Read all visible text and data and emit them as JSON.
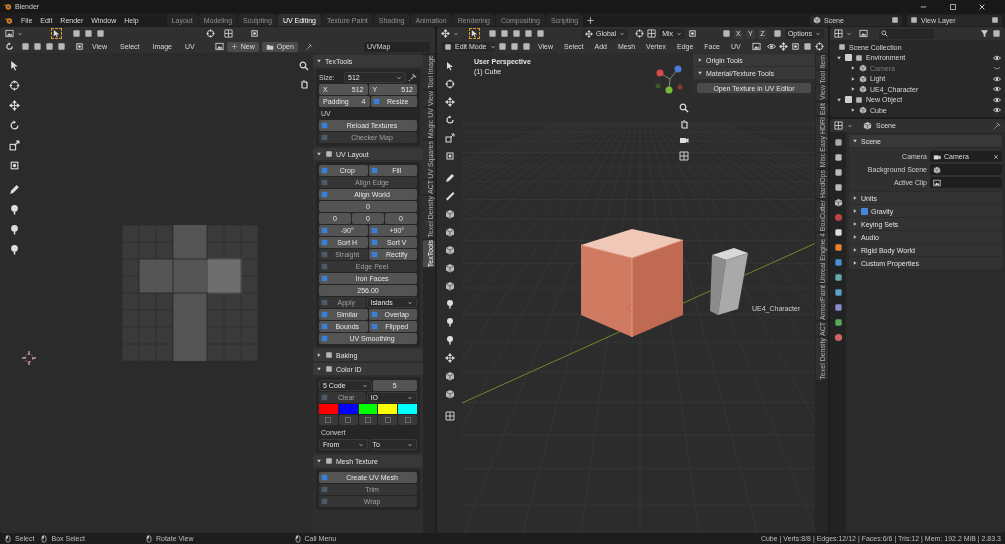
{
  "window": {
    "title": "Blender"
  },
  "menu": [
    "File",
    "Edit",
    "Render",
    "Window",
    "Help"
  ],
  "workspaces": [
    {
      "label": "Layout",
      "selected": false
    },
    {
      "label": "Modeling",
      "selected": false
    },
    {
      "label": "Sculpting",
      "selected": false
    },
    {
      "label": "UV Editing",
      "selected": true
    },
    {
      "label": "Texture Paint",
      "selected": false
    },
    {
      "label": "Shading",
      "selected": false
    },
    {
      "label": "Animation",
      "selected": false
    },
    {
      "label": "Rendering",
      "selected": false
    },
    {
      "label": "Compositing",
      "selected": false
    },
    {
      "label": "Scripting",
      "selected": false
    }
  ],
  "scene": "Scene",
  "view_layer": "View Layer",
  "uv_editor": {
    "menus": [
      "View",
      "Select",
      "Image",
      "UV"
    ],
    "new_label": "New",
    "open_label": "Open",
    "uv_map": "UVMap",
    "tabs": [
      {
        "label": "Image",
        "selected": false
      },
      {
        "label": "Tool",
        "selected": false
      },
      {
        "label": "View",
        "selected": false
      },
      {
        "label": "Magic UV",
        "selected": false
      },
      {
        "label": "UV Squares",
        "selected": false
      },
      {
        "label": "ACT",
        "selected": false
      },
      {
        "label": "Texel Density",
        "selected": false
      },
      {
        "label": "TexTools",
        "selected": true
      }
    ],
    "panels": [
      {
        "title": "TexTools",
        "expanded": true,
        "rows": [
          [
            {
              "kind": "select",
              "label": "Size:",
              "value": "512"
            }
          ],
          [
            {
              "kind": "prop",
              "label": "X",
              "value": "512"
            },
            {
              "kind": "prop",
              "label": "Y",
              "value": "512"
            }
          ],
          [
            {
              "kind": "prop",
              "label": "Padding",
              "value": "4"
            },
            {
              "kind": "button",
              "label": "Resize",
              "disabled": false
            }
          ],
          [
            {
              "kind": "text",
              "label": "UV"
            }
          ],
          [
            {
              "kind": "button",
              "label": "Reload Textures",
              "disabled": false
            }
          ],
          [
            {
              "kind": "button",
              "label": "Checker Map",
              "disabled": true
            }
          ]
        ]
      },
      {
        "title": "UV Layout",
        "expanded": true,
        "rows": [
          [
            {
              "kind": "button",
              "label": "Crop",
              "disabled": false
            },
            {
              "kind": "button",
              "label": "Fill",
              "disabled": false
            }
          ],
          [
            {
              "kind": "button",
              "label": "Align Edge",
              "disabled": true
            }
          ],
          [
            {
              "kind": "button",
              "label": "Align World",
              "disabled": false
            }
          ],
          [
            {
              "kind": "number",
              "value": "0"
            }
          ],
          [
            {
              "kind": "number",
              "value": "0"
            },
            {
              "kind": "number",
              "value": "0"
            },
            {
              "kind": "number",
              "value": "0"
            }
          ],
          [
            {
              "kind": "button",
              "label": "-90°",
              "disabled": false
            },
            {
              "kind": "button",
              "label": "+90°",
              "disabled": false
            }
          ],
          [
            {
              "kind": "button",
              "label": "Sort H",
              "disabled": false
            },
            {
              "kind": "button",
              "label": "Sort V",
              "disabled": false
            }
          ],
          [
            {
              "kind": "button",
              "label": "Straight",
              "disabled": true
            },
            {
              "kind": "button",
              "label": "Rectify",
              "disabled": false
            }
          ],
          [
            {
              "kind": "button",
              "label": "Edge Peel",
              "disabled": true
            }
          ],
          [
            {
              "kind": "button",
              "label": "Iron Faces",
              "disabled": false
            }
          ],
          [
            {
              "kind": "number",
              "value": "256.00"
            }
          ],
          [
            {
              "kind": "button",
              "label": "Apply",
              "disabled": true
            },
            {
              "kind": "select",
              "value": "Islands"
            }
          ],
          [
            {
              "kind": "button",
              "label": "Similar",
              "disabled": false
            },
            {
              "kind": "button",
              "label": "Overlap",
              "disabled": false
            }
          ],
          [
            {
              "kind": "button",
              "label": "Bounds",
              "disabled": false
            },
            {
              "kind": "button",
              "label": "Flipped",
              "disabled": false
            }
          ],
          [
            {
              "kind": "button",
              "label": "UV Smoothing",
              "disabled": false
            }
          ]
        ]
      },
      {
        "title": "Baking",
        "expanded": false
      },
      {
        "title": "Color ID",
        "expanded": true,
        "rows": [
          [
            {
              "kind": "select",
              "value": "5 Code"
            },
            {
              "kind": "number",
              "value": "5"
            }
          ],
          [
            {
              "kind": "button",
              "label": "Clear",
              "disabled": true
            },
            {
              "kind": "select",
              "value": "IO"
            }
          ],
          [
            {
              "kind": "swatch",
              "color": "#ff0000"
            },
            {
              "kind": "swatch",
              "color": "#0000ff"
            },
            {
              "kind": "swatch",
              "color": "#00ff00"
            },
            {
              "kind": "swatch",
              "color": "#ffff00"
            },
            {
              "kind": "swatch",
              "color": "#00ffff"
            }
          ],
          [
            {
              "kind": "text",
              "label": "Convert"
            }
          ],
          [
            {
              "kind": "select",
              "value": "From"
            },
            {
              "kind": "select",
              "value": "To"
            }
          ]
        ]
      },
      {
        "title": "Mesh Texture",
        "expanded": true,
        "rows": [
          [
            {
              "kind": "button",
              "label": "Create UV Mesh",
              "disabled": false
            }
          ],
          [
            {
              "kind": "button",
              "label": "Trim",
              "disabled": true
            }
          ],
          [
            {
              "kind": "button",
              "label": "Wrap",
              "disabled": true
            }
          ]
        ]
      }
    ]
  },
  "viewport": {
    "mode": "Edit Mode",
    "menus": [
      "View",
      "Select",
      "Add",
      "Mesh",
      "Vertex",
      "Edge",
      "Face",
      "UV"
    ],
    "orientation": "Global",
    "snap_target": "Mix",
    "axes": [
      "X",
      "Y",
      "Z"
    ],
    "options": "Options",
    "view_name": "User Perspective",
    "object_name": "(1) Cube",
    "object_label": "UE4_Character",
    "sidebar_panels": [
      {
        "title": "Origin Tools",
        "expanded": false
      },
      {
        "title": "Material/Texture Tools",
        "expanded": true,
        "button": "Open Texture in UV Editor"
      }
    ],
    "tabs": [
      {
        "label": "Item",
        "selected": false
      },
      {
        "label": "Tool",
        "selected": false
      },
      {
        "label": "View",
        "selected": false
      },
      {
        "label": "Edit",
        "selected": false
      },
      {
        "label": "Easy HDRI",
        "selected": false
      },
      {
        "label": "Misc",
        "selected": false
      },
      {
        "label": "HardOps",
        "selected": false
      },
      {
        "label": "BoxCutter",
        "selected": false
      },
      {
        "label": "Unreal Engine 4",
        "selected": false
      },
      {
        "label": "ArmorPaint",
        "selected": false
      },
      {
        "label": "ACT",
        "selected": false
      },
      {
        "label": "Texel Density",
        "selected": false
      }
    ]
  },
  "outliner": {
    "root": "Scene Collection",
    "items": [
      {
        "label": "Environment",
        "checked": true,
        "visible": true,
        "expanded": true,
        "children": [
          {
            "label": "Camera",
            "visible": false,
            "expanded": false
          },
          {
            "label": "Light",
            "visible": true,
            "expanded": false
          },
          {
            "label": "UE4_Character",
            "visible": true,
            "expanded": false
          }
        ]
      },
      {
        "label": "New Object",
        "checked": true,
        "visible": true,
        "expanded": true,
        "children": [
          {
            "label": "Cube",
            "visible": true,
            "expanded": false
          }
        ]
      }
    ]
  },
  "properties": {
    "context": "Scene",
    "panel": {
      "title": "Scene",
      "expanded": true,
      "fields": [
        {
          "label": "Camera",
          "value": "Camera"
        },
        {
          "label": "Background Scene"
        },
        {
          "label": "Active Clip"
        }
      ]
    },
    "subpanels": [
      {
        "kind": "plain",
        "label": "Units",
        "expanded": false
      },
      {
        "kind": "checkbox",
        "label": "Gravity",
        "expanded": false,
        "checked": true
      },
      {
        "kind": "plain",
        "label": "Keying Sets",
        "expanded": false
      },
      {
        "kind": "plain",
        "label": "Audio",
        "expanded": false
      },
      {
        "kind": "plain",
        "label": "Rigid Body World",
        "expanded": false
      },
      {
        "kind": "plain",
        "label": "Custom Properties",
        "expanded": false
      }
    ]
  },
  "status_bar": {
    "hints": [
      "Select",
      "Box Select",
      "Rotate View",
      "Call Menu"
    ],
    "stats": "Cube | Verts:8/8 | Edges:12/12 | Faces:6/6 | Tris:12 | Mem: 192.2 MiB | 2.83.3"
  }
}
